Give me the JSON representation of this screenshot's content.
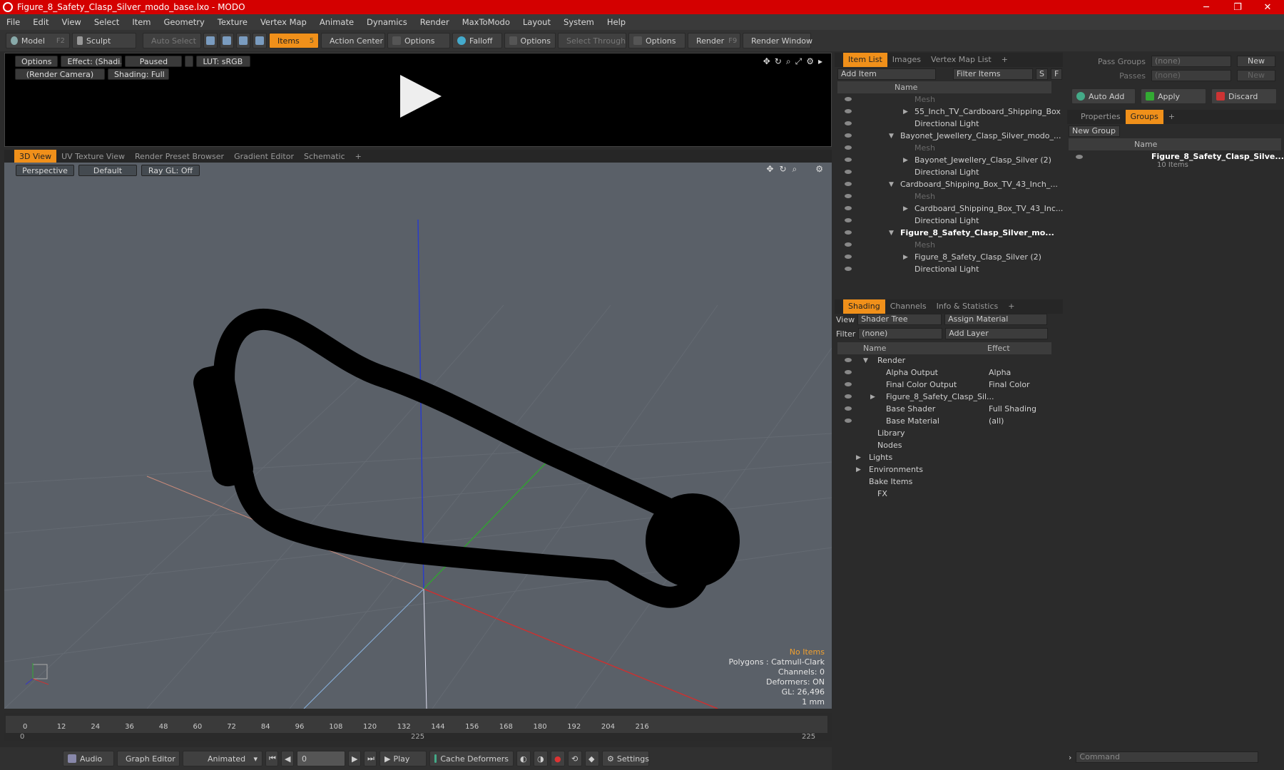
{
  "window": {
    "title": "Figure_8_Safety_Clasp_Silver_modo_base.lxo - MODO",
    "minimize": "─",
    "maximize": "❐",
    "close": "✕"
  },
  "menu": [
    "File",
    "Edit",
    "View",
    "Select",
    "Item",
    "Geometry",
    "Texture",
    "Vertex Map",
    "Animate",
    "Dynamics",
    "Render",
    "MaxToModo",
    "Layout",
    "System",
    "Help"
  ],
  "toolbar": {
    "model": "Model",
    "model_key": "F2",
    "sculpt": "Sculpt",
    "auto_select": "Auto Select",
    "items": "Items",
    "items_key": "5",
    "action_center": "Action Center",
    "options1": "Options",
    "falloff": "Falloff",
    "options2": "Options",
    "select_through": "Select Through",
    "options3": "Options",
    "render": "Render",
    "render_key": "F9",
    "render_window": "Render Window"
  },
  "preview": {
    "options": "Options",
    "effect": "Effect: (Shadi...",
    "paused": "Paused",
    "lut": "LUT: sRGB",
    "camera": "(Render Camera)",
    "shading": "Shading: Full"
  },
  "viewtabs": [
    "3D View",
    "UV Texture View",
    "Render Preset Browser",
    "Gradient Editor",
    "Schematic",
    "+"
  ],
  "viewport": {
    "perspective": "Perspective",
    "default": "Default",
    "raygl": "Ray GL: Off",
    "stats": {
      "items": "No Items",
      "polygons": "Polygons : Catmull-Clark",
      "channels": "Channels: 0",
      "deformers": "Deformers: ON",
      "gl": "GL: 26,496",
      "unit": "1 mm"
    }
  },
  "timeline": {
    "ticks": [
      "0",
      "12",
      "24",
      "36",
      "48",
      "60",
      "72",
      "84",
      "96",
      "108",
      "120",
      "132",
      "144",
      "156",
      "168",
      "180",
      "192",
      "204",
      "216"
    ],
    "start": "0",
    "mid": "225",
    "end": "225"
  },
  "bottom": {
    "audio": "Audio",
    "graph_editor": "Graph Editor",
    "animated": "Animated",
    "frame": "0",
    "play": "Play",
    "cache": "Cache Deformers",
    "settings": "Settings"
  },
  "itemlist": {
    "tabs": [
      "Item List",
      "Images",
      "Vertex Map List",
      "+"
    ],
    "add_item": "Add Item",
    "filter": "Filter Items",
    "s": "S",
    "f": "F",
    "name_col": "Name",
    "rows": [
      {
        "label": "Mesh",
        "indent": 3,
        "dim": true
      },
      {
        "label": "55_Inch_TV_Cardboard_Shipping_Box",
        "indent": 3,
        "arrow": "▶"
      },
      {
        "label": "Directional Light",
        "indent": 3
      },
      {
        "label": "Bayonet_Jewellery_Clasp_Silver_modo_...",
        "indent": 1,
        "arrow": "▼"
      },
      {
        "label": "Mesh",
        "indent": 3,
        "dim": true
      },
      {
        "label": "Bayonet_Jewellery_Clasp_Silver (2)",
        "indent": 3,
        "arrow": "▶"
      },
      {
        "label": "Directional Light",
        "indent": 3
      },
      {
        "label": "Cardboard_Shipping_Box_TV_43_Inch_...",
        "indent": 1,
        "arrow": "▼"
      },
      {
        "label": "Mesh",
        "indent": 3,
        "dim": true
      },
      {
        "label": "Cardboard_Shipping_Box_TV_43_Inc...",
        "indent": 3,
        "arrow": "▶"
      },
      {
        "label": "Directional Light",
        "indent": 3
      },
      {
        "label": "Figure_8_Safety_Clasp_Silver_mo...",
        "indent": 1,
        "arrow": "▼",
        "bold": true
      },
      {
        "label": "Mesh",
        "indent": 3,
        "dim": true
      },
      {
        "label": "Figure_8_Safety_Clasp_Silver (2)",
        "indent": 3,
        "arrow": "▶"
      },
      {
        "label": "Directional Light",
        "indent": 3
      }
    ]
  },
  "shading": {
    "tabs": [
      "Shading",
      "Channels",
      "Info & Statistics",
      "+"
    ],
    "view_label": "View",
    "view_val": "Shader Tree",
    "assign": "Assign Material",
    "filter_label": "Filter",
    "filter_val": "(none)",
    "add_layer": "Add Layer",
    "name_col": "Name",
    "effect_col": "Effect",
    "rows": [
      {
        "label": "Render",
        "effect": "",
        "indent": 1,
        "arrow": "▼"
      },
      {
        "label": "Alpha Output",
        "effect": "Alpha",
        "indent": 2
      },
      {
        "label": "Final Color Output",
        "effect": "Final Color",
        "indent": 2
      },
      {
        "label": "Figure_8_Safety_Clasp_Sil...",
        "effect": "",
        "indent": 2,
        "arrow": "▶"
      },
      {
        "label": "Base Shader",
        "effect": "Full Shading",
        "indent": 2
      },
      {
        "label": "Base Material",
        "effect": "(all)",
        "indent": 2
      },
      {
        "label": "Library",
        "effect": "",
        "indent": 1
      },
      {
        "label": "Nodes",
        "effect": "",
        "indent": 1
      },
      {
        "label": "Lights",
        "effect": "",
        "indent": 0,
        "arrow": "▶"
      },
      {
        "label": "Environments",
        "effect": "",
        "indent": 0,
        "arrow": "▶"
      },
      {
        "label": "Bake Items",
        "effect": "",
        "indent": 0
      },
      {
        "label": "FX",
        "effect": "",
        "indent": 1
      }
    ]
  },
  "groups": {
    "pass_groups": "Pass Groups",
    "passes": "Passes",
    "none": "(none)",
    "new": "New",
    "auto_add": "Auto Add",
    "apply": "Apply",
    "discard": "Discard",
    "tabs": [
      "Properties",
      "Groups",
      "+"
    ],
    "new_group": "New Group",
    "name_col": "Name",
    "item": "Figure_8_Safety_Clasp_Silve...",
    "item_count": "10 Items",
    "command": "Command"
  }
}
